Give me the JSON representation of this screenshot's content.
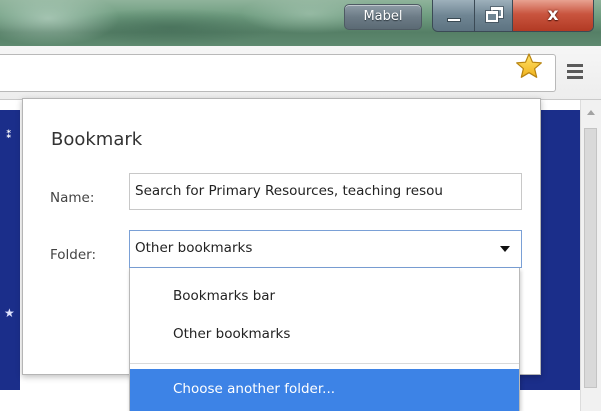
{
  "window": {
    "profile_name": "Mabel",
    "close_glyph": "x"
  },
  "toolbar": {
    "star_icon": "star-icon",
    "menu_icon": "menu-icon",
    "star_color": "#f5c518"
  },
  "bookmark_bubble": {
    "title": "Bookmark",
    "name_label": "Name:",
    "name_value": "Search for Primary Resources, teaching resou",
    "folder_label": "Folder:",
    "folder_selected": "Other bookmarks"
  },
  "folder_dropdown": {
    "options": [
      {
        "label": "Bookmarks bar"
      },
      {
        "label": "Other bookmarks"
      }
    ],
    "choose_another": "Choose another folder...",
    "highlight_color": "#3d83e6"
  }
}
